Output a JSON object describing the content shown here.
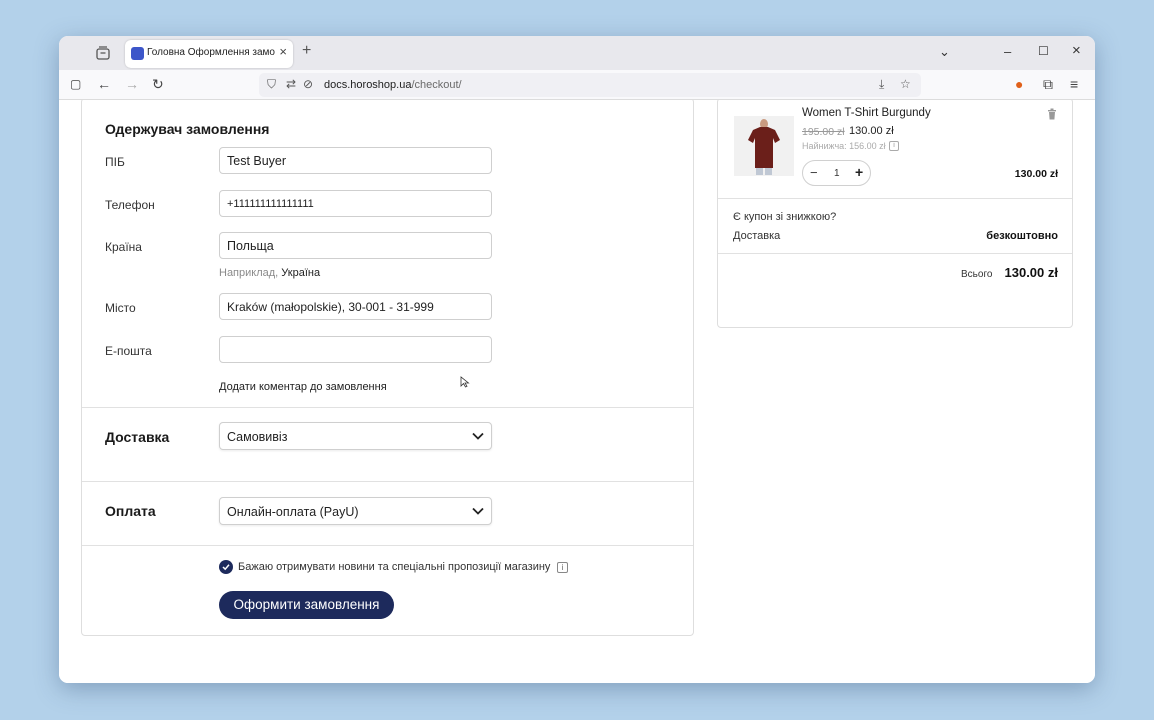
{
  "browser": {
    "tab_title": "Головна Оформлення замовлення",
    "url_host": "docs.horoshop.ua",
    "url_path": "/checkout/"
  },
  "recipient": {
    "title": "Одержувач замовлення",
    "name_label": "ПІБ",
    "name_value": "Test Buyer",
    "phone_label": "Телефон",
    "phone_value": "+111111111111111",
    "country_label": "Країна",
    "country_value": "Польща",
    "country_hint_prefix": "Наприклад,",
    "country_hint_example": "Україна",
    "city_label": "Місто",
    "city_value": "Kraków (małopolskie), 30-001 - 31-999",
    "email_label": "E-пошта",
    "email_value": "",
    "comment_link": "Додати коментар до замовлення"
  },
  "delivery": {
    "title": "Доставка",
    "selected": "Самовивіз"
  },
  "payment": {
    "title": "Оплата",
    "selected": "Онлайн-оплата (PayU)"
  },
  "newsletter": {
    "label": "Бажаю отримувати новини та спеціальні пропозиції магазину",
    "checked": true
  },
  "submit_label": "Оформити замовлення",
  "cart": {
    "product_name": "Women T-Shirt Burgundy",
    "old_price": "195.00 zł",
    "new_price": "130.00 zł",
    "lowest_price": "Найнижча: 156.00 zł",
    "quantity": "1",
    "line_total": "130.00 zł",
    "coupon": "Є купон зі знижкою?",
    "delivery_label": "Доставка",
    "delivery_value": "безкоштовно",
    "total_label": "Всього",
    "total_value": "130.00 zł"
  },
  "colors": {
    "accent": "#1d2a5c",
    "background": "#b3d1ea",
    "shirt": "#6b1f1a"
  }
}
